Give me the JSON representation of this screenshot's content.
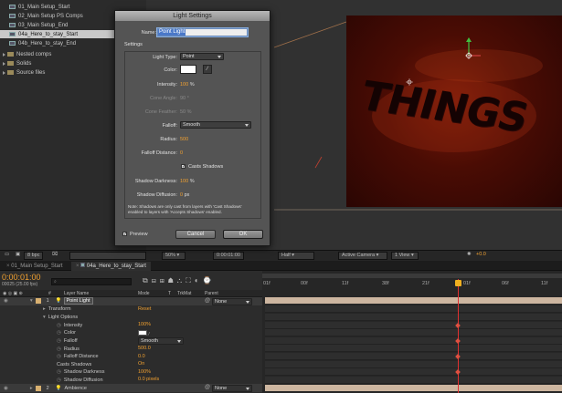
{
  "project": {
    "items": [
      {
        "label": "01_Main Setup_Start",
        "kind": "comp",
        "selected": false
      },
      {
        "label": "02_Main Setup PS Comps",
        "kind": "comp",
        "selected": false
      },
      {
        "label": "03_Main Setup_End",
        "kind": "comp",
        "selected": false
      },
      {
        "label": "04a_Here_to_stay_Start",
        "kind": "comp",
        "selected": true
      },
      {
        "label": "04b_Here_to_stay_End",
        "kind": "comp",
        "selected": false
      },
      {
        "label": "Nested comps",
        "kind": "folder",
        "selected": false
      },
      {
        "label": "Solids",
        "kind": "folder",
        "selected": false
      },
      {
        "label": "Source files",
        "kind": "folder",
        "selected": false
      }
    ],
    "bpc": "8 bpc"
  },
  "dialog": {
    "title": "Light Settings",
    "name_label": "Name:",
    "name_value": "Point Light",
    "settings_label": "Settings",
    "light_type_label": "Light Type:",
    "light_type_value": "Point",
    "color_label": "Color:",
    "intensity_label": "Intensity:",
    "intensity_value": "100",
    "intensity_unit": "%",
    "cone_angle_label": "Cone Angle:",
    "cone_angle_value": "90 °",
    "cone_feather_label": "Cone Feather:",
    "cone_feather_value": "50 %",
    "falloff_label": "Falloff:",
    "falloff_value": "Smooth",
    "radius_label": "Radius:",
    "radius_value": "500",
    "falloff_distance_label": "Falloff Distance:",
    "falloff_distance_value": "0",
    "casts_shadows_label": "Casts Shadows",
    "shadow_darkness_label": "Shadow Darkness:",
    "shadow_darkness_value": "100",
    "shadow_darkness_unit": "%",
    "shadow_diffusion_label": "Shadow Diffusion:",
    "shadow_diffusion_value": "0",
    "shadow_diffusion_unit": "px",
    "note_line1": "Note: Shadows are only cast from layers with 'Cast Shadows'",
    "note_line2": "enabled to layers with 'Accepts Shadows' enabled.",
    "preview_label": "Preview",
    "cancel_label": "Cancel",
    "ok_label": "OK"
  },
  "viewer": {
    "zoom": "50%",
    "timecode": "0:00:01:00",
    "resolution": "Half",
    "camera": "Active Camera",
    "views": "1 View",
    "exposure": "+0.0",
    "canvas_text": "THINGS"
  },
  "timeline": {
    "tabs": [
      "01_Main Setup_Start",
      "04a_Here_to_stay_Start"
    ],
    "timecode": "0:00:01:00",
    "frame_info": "00025 (25.00 fps)",
    "col_layer_name": "Layer Name",
    "col_mode": "Mode",
    "col_t": "T",
    "col_trkmat": "TrkMat",
    "col_parent": "Parent",
    "ruler": [
      "01f",
      "00f",
      "11f",
      "38f",
      "21f",
      "01f",
      "06f",
      "11f"
    ],
    "layer1": {
      "num": "1",
      "name": "Point Light",
      "parent": "None"
    },
    "transform_label": "Transform",
    "reset_label": "Reset",
    "light_options_label": "Light Options",
    "props": [
      {
        "label": "Intensity",
        "value": "100%"
      },
      {
        "label": "Color",
        "value": ""
      },
      {
        "label": "Falloff",
        "value": "Smooth"
      },
      {
        "label": "Radius",
        "value": "500.0"
      },
      {
        "label": "Falloff Distance",
        "value": "0.0"
      },
      {
        "label": "Casts Shadows",
        "value": "On"
      },
      {
        "label": "Shadow Darkness",
        "value": "100%"
      },
      {
        "label": "Shadow Diffusion",
        "value": "0.0 pixels"
      }
    ],
    "layer2": {
      "num": "2",
      "name": "Ambience",
      "parent": "None"
    }
  }
}
